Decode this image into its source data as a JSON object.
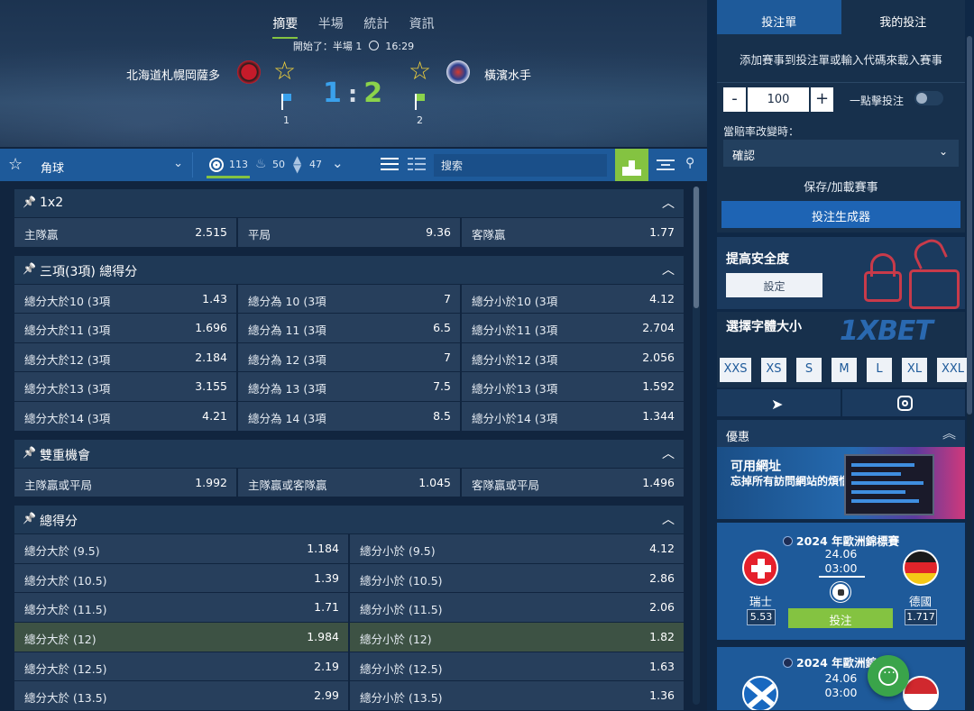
{
  "colors": {
    "accent_green": "#84c341",
    "accent_blue": "#1e5a9a",
    "home_score": "#3aa1ec",
    "away_score": "#8bd34b",
    "panel_bg": "#11253f"
  },
  "match_header": {
    "tabs": [
      "摘要",
      "半場",
      "統計",
      "資訊"
    ],
    "active_tab": "摘要",
    "started_label": "開始了：半場 1",
    "clock_time": "16:29",
    "home_team": "北海道札幌岡薩多",
    "away_team": "橫濱水手",
    "home_score": "1",
    "score_sep": ":",
    "away_score": "2",
    "home_flag_count": "1",
    "away_flag_count": "2"
  },
  "toolbar": {
    "market": "角球",
    "market_count": "113",
    "hot_count": "50",
    "moves_count": "47",
    "search_placeholder": "搜索"
  },
  "markets": [
    {
      "title": "1x2",
      "rows": [
        [
          {
            "label": "主隊贏",
            "odd": "2.515"
          },
          {
            "label": "平局",
            "odd": "9.36"
          },
          {
            "label": "客隊贏",
            "odd": "1.77"
          }
        ]
      ]
    },
    {
      "title": "三項(3項) 總得分",
      "rows": [
        [
          {
            "label": "總分大於10 (3項",
            "odd": "1.43"
          },
          {
            "label": "總分為 10 (3項",
            "odd": "7"
          },
          {
            "label": "總分小於10 (3項",
            "odd": "4.12"
          }
        ],
        [
          {
            "label": "總分大於11 (3項",
            "odd": "1.696"
          },
          {
            "label": "總分為 11 (3項",
            "odd": "6.5"
          },
          {
            "label": "總分小於11 (3項",
            "odd": "2.704"
          }
        ],
        [
          {
            "label": "總分大於12 (3項",
            "odd": "2.184"
          },
          {
            "label": "總分為 12 (3項",
            "odd": "7"
          },
          {
            "label": "總分小於12 (3項",
            "odd": "2.056"
          }
        ],
        [
          {
            "label": "總分大於13 (3項",
            "odd": "3.155"
          },
          {
            "label": "總分為 13 (3項",
            "odd": "7.5"
          },
          {
            "label": "總分小於13 (3項",
            "odd": "1.592"
          }
        ],
        [
          {
            "label": "總分大於14 (3項",
            "odd": "4.21"
          },
          {
            "label": "總分為 14 (3項",
            "odd": "8.5"
          },
          {
            "label": "總分小於14 (3項",
            "odd": "1.344"
          }
        ]
      ]
    },
    {
      "title": "雙重機會",
      "rows": [
        [
          {
            "label": "主隊贏或平局",
            "odd": "1.992"
          },
          {
            "label": "主隊贏或客隊贏",
            "odd": "1.045"
          },
          {
            "label": "客隊贏或平局",
            "odd": "1.496"
          }
        ]
      ]
    },
    {
      "title": "總得分",
      "rows": [
        [
          {
            "label": "總分大於 (9.5)",
            "odd": "1.184"
          },
          {
            "label": "總分小於 (9.5)",
            "odd": "4.12"
          }
        ],
        [
          {
            "label": "總分大於 (10.5)",
            "odd": "1.39"
          },
          {
            "label": "總分小於 (10.5)",
            "odd": "2.86"
          }
        ],
        [
          {
            "label": "總分大於 (11.5)",
            "odd": "1.71"
          },
          {
            "label": "總分小於 (11.5)",
            "odd": "2.06"
          }
        ],
        [
          {
            "label": "總分大於 (12)",
            "odd": "1.984",
            "highlight": true
          },
          {
            "label": "總分小於 (12)",
            "odd": "1.82",
            "highlight": true
          }
        ],
        [
          {
            "label": "總分大於 (12.5)",
            "odd": "2.19"
          },
          {
            "label": "總分小於 (12.5)",
            "odd": "1.63"
          }
        ],
        [
          {
            "label": "總分大於 (13.5)",
            "odd": "2.99"
          },
          {
            "label": "總分小於 (13.5)",
            "odd": "1.36"
          }
        ]
      ]
    }
  ],
  "betslip": {
    "tab_active": "投注單",
    "tab_other": "我的投注",
    "hint": "添加賽事到投注單或輸入代碼來載入賽事",
    "minus": "-",
    "plus": "+",
    "stake": "100",
    "one_click": "一點擊投注",
    "odds_change_label": "當賠率改變時：",
    "odds_change_value": "確認",
    "save_label": "保存/加載賽事",
    "generator_label": "投注生成器"
  },
  "security": {
    "title": "提高安全度",
    "button": "設定"
  },
  "font_size": {
    "title": "選擇字體大小",
    "brand": "1XBET",
    "sizes": [
      "XXS",
      "XS",
      "S",
      "M",
      "L",
      "XL",
      "XXL"
    ]
  },
  "promo": {
    "header": "優惠",
    "banner_line1": "可用網址",
    "banner_line2": "忘掉所有訪問網站的煩惱吧！"
  },
  "featured_match": {
    "league": "2024 年歐洲錦標賽",
    "date": "24.06",
    "time": "03:00",
    "home": "瑞士",
    "away": "德國",
    "home_odd": "5.53",
    "away_odd": "1.717",
    "bet_label": "投注"
  },
  "featured_match2": {
    "league": "2024 年歐洲錦",
    "date": "24.06",
    "time": "03:00"
  }
}
